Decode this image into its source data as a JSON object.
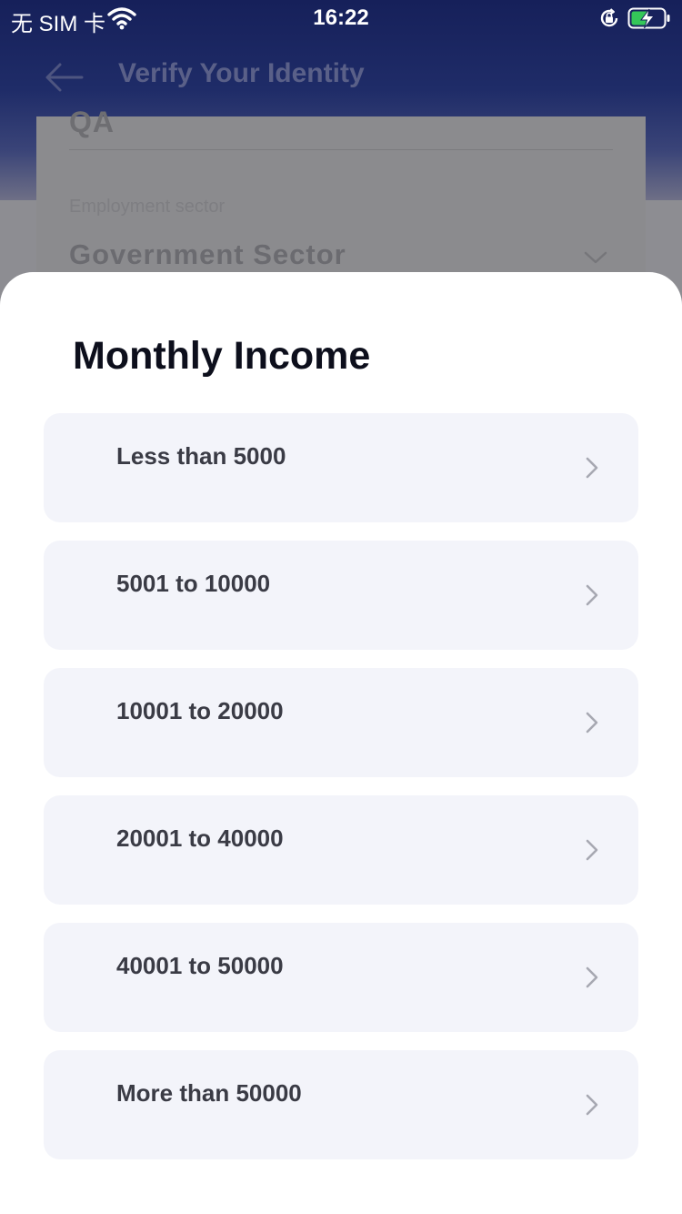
{
  "status_bar": {
    "carrier": "无 SIM 卡",
    "time": "16:22",
    "icons": [
      "wifi-icon",
      "orientation-lock-icon",
      "battery-charging-icon"
    ]
  },
  "background_page": {
    "title": "Verify Your Identity",
    "previous_field_value": "QA",
    "employment_sector": {
      "label": "Employment sector",
      "value": "Government Sector"
    }
  },
  "sheet": {
    "title": "Monthly Income",
    "options": [
      {
        "label": "Less than 5000"
      },
      {
        "label": "5001 to 10000"
      },
      {
        "label": "10001 to 20000"
      },
      {
        "label": "20001 to 40000"
      },
      {
        "label": "40001 to 50000"
      },
      {
        "label": "More than 50000"
      }
    ]
  },
  "colors": {
    "header_navy": "#16205a",
    "option_background": "#f3f4fa",
    "title_text": "#0d0f1c",
    "option_text": "#3a3b45",
    "battery_charging": "#34c759"
  }
}
